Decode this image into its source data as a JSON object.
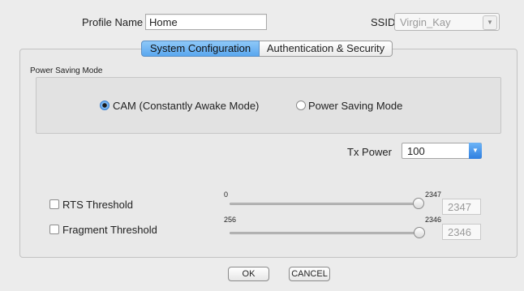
{
  "profile": {
    "label": "Profile Name",
    "value": "Home"
  },
  "ssid": {
    "label": "SSID",
    "value": "Virgin_Kay"
  },
  "tabs": [
    {
      "label": "System Configuration",
      "active": true
    },
    {
      "label": "Authentication & Security",
      "active": false
    }
  ],
  "power_saving": {
    "group_label": "Power Saving Mode",
    "options": [
      {
        "label": "CAM (Constantly Awake Mode)",
        "selected": true
      },
      {
        "label": "Power Saving Mode",
        "selected": false
      }
    ]
  },
  "tx_power": {
    "label": "Tx Power",
    "value": "100"
  },
  "rts": {
    "label": "RTS Threshold",
    "checked": false,
    "min_label": "0",
    "max_label": "2347",
    "value": "2347"
  },
  "fragment": {
    "label": "Fragment Threshold",
    "checked": false,
    "min_label": "256",
    "max_label": "2346",
    "value": "2346"
  },
  "buttons": {
    "ok": "OK",
    "cancel": "CANCEL"
  },
  "colors": {
    "tab_active": "#5aa7ef",
    "select_arrow": "#2f7fe0"
  }
}
